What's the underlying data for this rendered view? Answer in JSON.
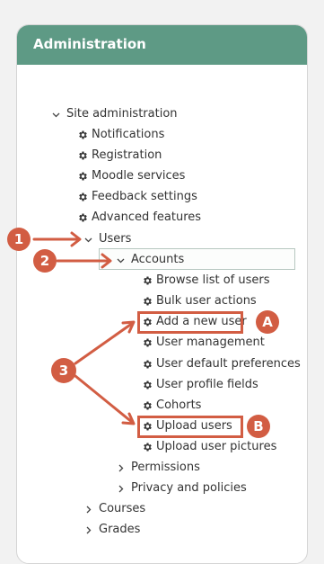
{
  "panel": {
    "title": "Administration"
  },
  "tree": {
    "site_admin": "Site administration",
    "items": [
      {
        "label": "Notifications",
        "icon": "gear-icon"
      },
      {
        "label": "Registration",
        "icon": "gear-icon"
      },
      {
        "label": "Moodle services",
        "icon": "gear-icon"
      },
      {
        "label": "Feedback settings",
        "icon": "gear-icon"
      },
      {
        "label": "Advanced features",
        "icon": "gear-icon"
      }
    ],
    "users": "Users",
    "accounts": "Accounts",
    "account_items": [
      {
        "label": "Browse list of users",
        "icon": "gear-icon"
      },
      {
        "label": "Bulk user actions",
        "icon": "gear-icon"
      },
      {
        "label": "Add a new user",
        "icon": "gear-icon"
      },
      {
        "label": "User management",
        "icon": "gear-icon"
      },
      {
        "label": "User default preferences",
        "icon": "gear-icon"
      },
      {
        "label": "User profile fields",
        "icon": "gear-icon"
      },
      {
        "label": "Cohorts",
        "icon": "gear-icon"
      },
      {
        "label": "Upload users",
        "icon": "gear-icon"
      },
      {
        "label": "Upload user pictures",
        "icon": "gear-icon"
      }
    ],
    "permissions": "Permissions",
    "privacy": "Privacy and policies",
    "courses": "Courses",
    "grades": "Grades"
  },
  "annotations": {
    "marker_1": "1",
    "marker_2": "2",
    "marker_3": "3",
    "marker_a": "A",
    "marker_b": "B",
    "accent_color": "#d25d43"
  },
  "colors": {
    "header_bg": "#5e9a85",
    "text": "#333333"
  }
}
